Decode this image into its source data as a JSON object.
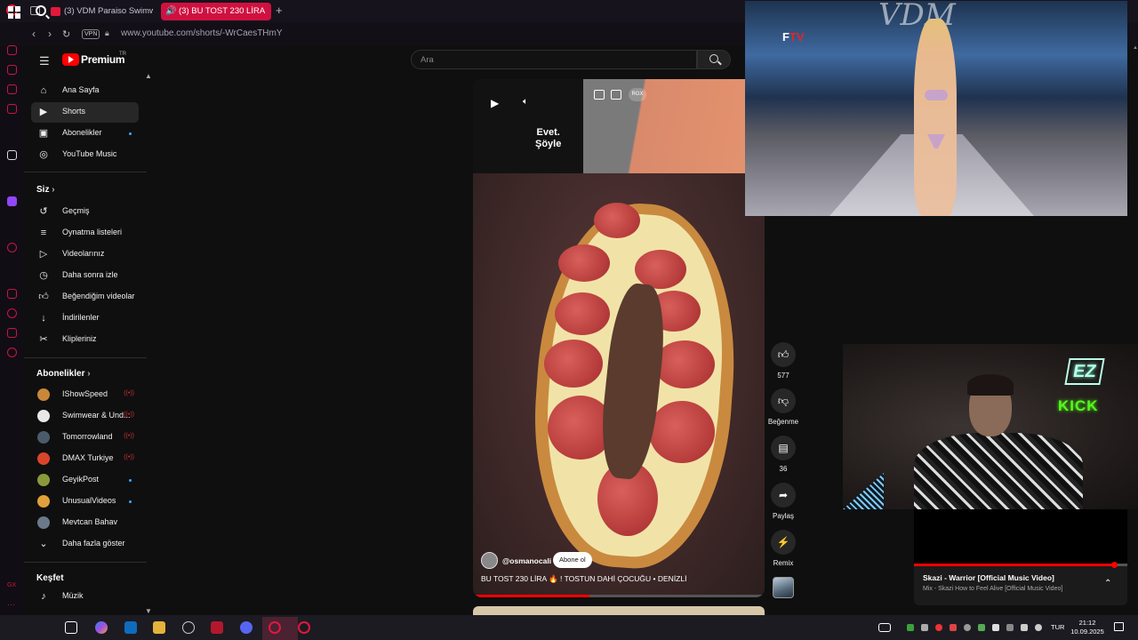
{
  "browser": {
    "tabs": [
      {
        "title": "(3) VDM Paraiso Swimwear"
      },
      {
        "title": "(3) BU TOST 230 LİRA"
      }
    ],
    "new_tab": "+",
    "vpn": "VPN",
    "url": "www.youtube.com/shorts/-WrCaesTHmY"
  },
  "youtube": {
    "logo_text": "Premium",
    "country": "TR",
    "search_placeholder": "Ara",
    "nav": [
      {
        "label": "Ana Sayfa",
        "icon": "home-icon"
      },
      {
        "label": "Shorts",
        "icon": "shorts-icon"
      },
      {
        "label": "Abonelikler",
        "icon": "subscriptions-icon"
      },
      {
        "label": "YouTube Music",
        "icon": "music-icon"
      }
    ],
    "you_heading": "Siz",
    "you_items": [
      {
        "label": "Geçmiş",
        "icon": "history-icon"
      },
      {
        "label": "Oynatma listeleri",
        "icon": "playlist-icon"
      },
      {
        "label": "Videolarınız",
        "icon": "your-videos-icon"
      },
      {
        "label": "Daha sonra izle",
        "icon": "watch-later-icon"
      },
      {
        "label": "Beğendiğim videolar",
        "icon": "liked-icon"
      },
      {
        "label": "İndirilenler",
        "icon": "download-icon"
      },
      {
        "label": "Klipleriniz",
        "icon": "clips-icon"
      }
    ],
    "subs_heading": "Abonelikler",
    "subscriptions": [
      {
        "label": "IShowSpeed",
        "status": "live",
        "color": "#c9873a"
      },
      {
        "label": "Swimwear & Und...",
        "status": "live",
        "color": "#e8e8e8"
      },
      {
        "label": "Tomorrowland",
        "status": "live",
        "color": "#4b5b6b"
      },
      {
        "label": "DMAX Turkiye",
        "status": "live",
        "color": "#d9452a"
      },
      {
        "label": "GeyikPost",
        "status": "new",
        "color": "#8a9a3a"
      },
      {
        "label": "UnusualVideos",
        "status": "new",
        "color": "#e0a03a"
      },
      {
        "label": "Mevtcan Bahav",
        "status": "",
        "color": "#6a7a8a"
      }
    ],
    "show_more": "Daha fazla göster",
    "explore_heading": "Keşfet",
    "explore_items": [
      {
        "label": "Müzik",
        "icon": "music-note-icon"
      }
    ]
  },
  "short": {
    "overlay_text_1": "Evet.",
    "overlay_text_2": "Şöyle",
    "rgx": "RGX",
    "channel": "@osmanocali",
    "subscribe": "Abone ol",
    "title": "BU TOST 230 LİRA 🔥 ! TOSTUN DAHİ ÇOCUĞU • DENİZLİ",
    "progress": 0.4
  },
  "actions": {
    "likes": "577",
    "dislike_label": "Beğenme",
    "comments": "36",
    "share_label": "Paylaş",
    "remix_label": "Remix"
  },
  "overlays": {
    "runway_brand": "VDM",
    "ftv_logo_f": "F",
    "ftv_logo_tv": "TV",
    "ez_logo": "EZ",
    "kick_logo": "KICK"
  },
  "music_player": {
    "title": "Skazi - Warrior [Official Music Video]",
    "subtitle": "Mix - Skazi How to Feel Alive [Official Music Video]",
    "progress": 0.94
  },
  "taskbar": {
    "language": "TUR",
    "time": "21:12",
    "date": "10.09.2025"
  },
  "colors": {
    "accent": "#ff0000",
    "opera_red": "#e3183c",
    "kick_green": "#53fc18"
  }
}
